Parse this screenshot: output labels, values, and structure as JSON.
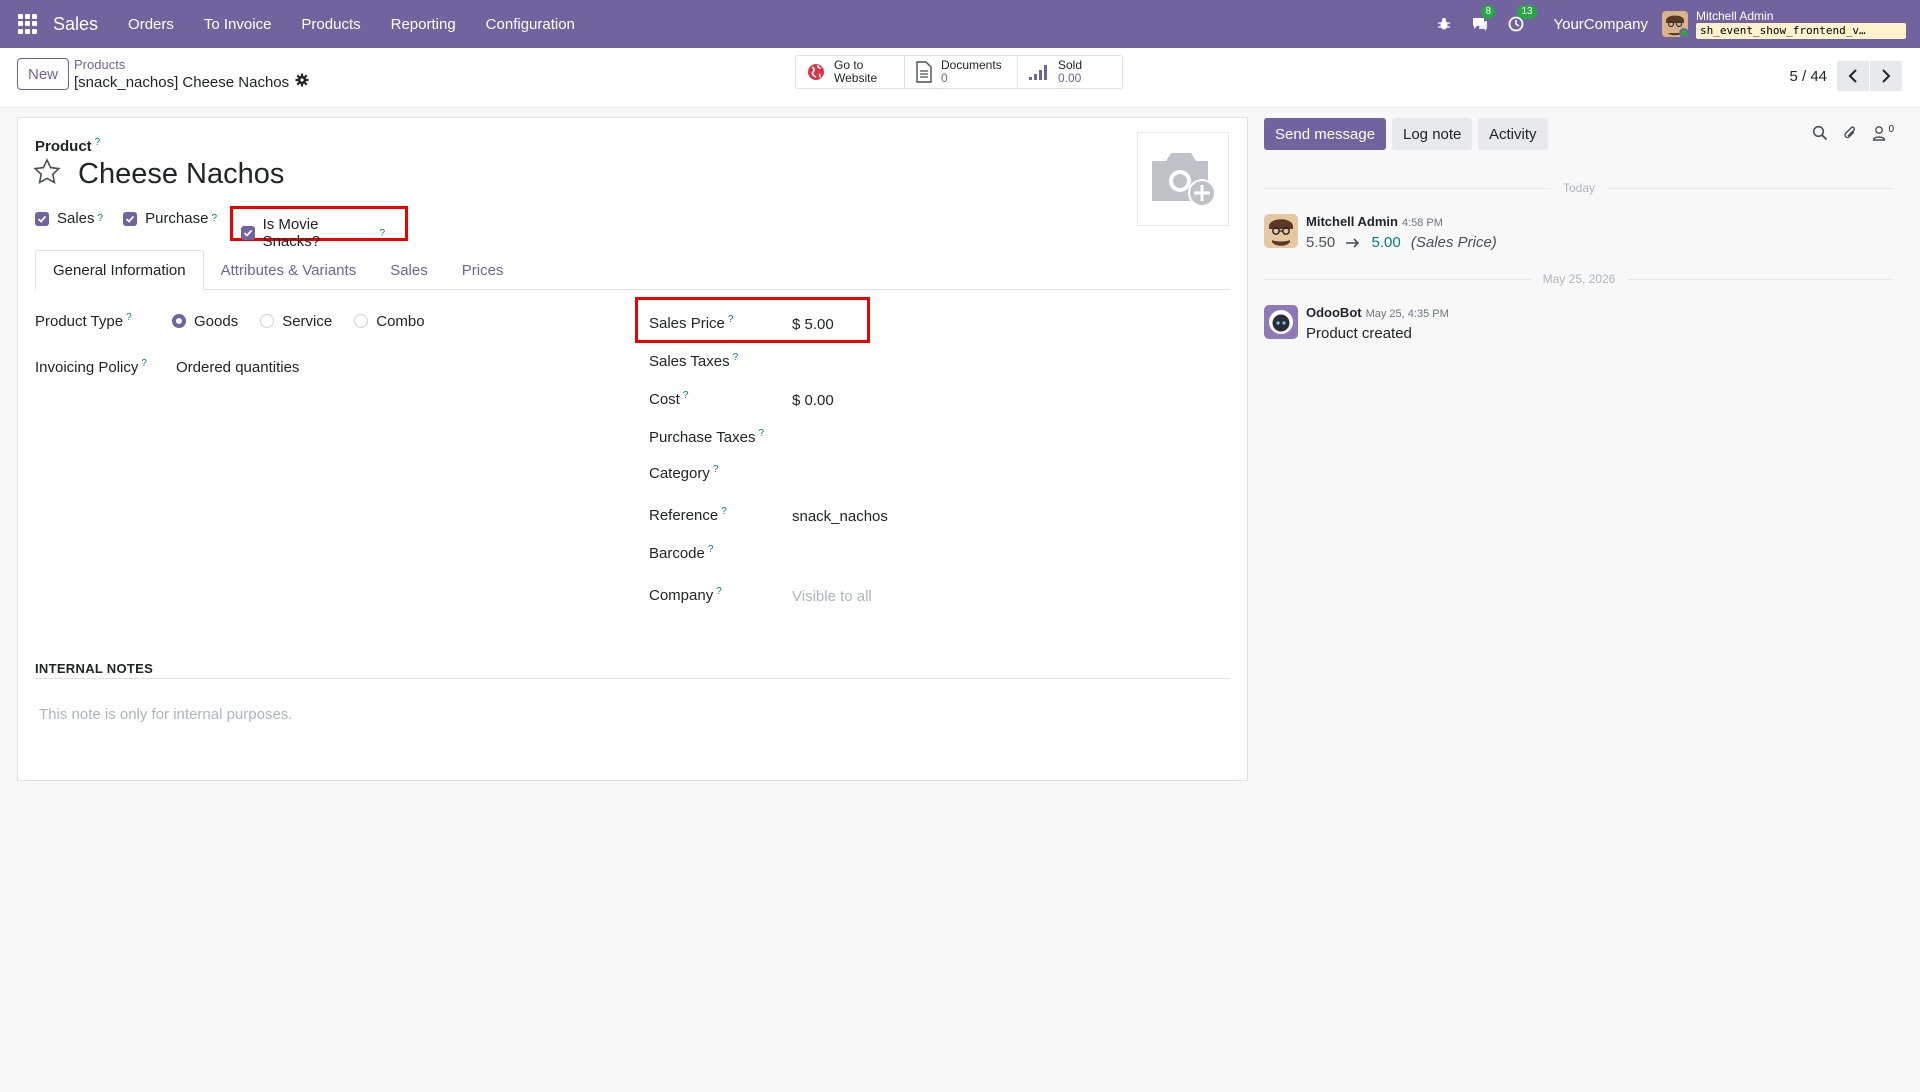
{
  "navbar": {
    "app_name": "Sales",
    "menu": [
      "Orders",
      "To Invoice",
      "Products",
      "Reporting",
      "Configuration"
    ],
    "messages_badge": "8",
    "activities_badge": "13",
    "company": "YourCompany",
    "user_name": "Mitchell Admin",
    "db_name": "sh_event_show_frontend_v…"
  },
  "control": {
    "new_label": "New",
    "breadcrumb_parent": "Products",
    "breadcrumb_current": "[snack_nachos] Cheese Nachos",
    "smart_buttons": {
      "website_line1": "Go to",
      "website_line2": "Website",
      "documents_label": "Documents",
      "documents_value": "0",
      "sold_label": "Sold",
      "sold_value": "0.00"
    },
    "pager": "5 / 44"
  },
  "form": {
    "product_label": "Product",
    "help_mark": "?",
    "title": "Cheese Nachos",
    "checkboxes": {
      "sales": "Sales",
      "purchase": "Purchase",
      "movie_snacks": "Is Movie Snacks?"
    },
    "tabs": [
      "General Information",
      "Attributes & Variants",
      "Sales",
      "Prices"
    ],
    "left": {
      "product_type_label": "Product Type",
      "product_type_options": [
        "Goods",
        "Service",
        "Combo"
      ],
      "product_type_selected": "Goods",
      "invoicing_policy_label": "Invoicing Policy",
      "invoicing_policy_value": "Ordered quantities"
    },
    "right": {
      "sales_price_label": "Sales Price",
      "sales_price_value": "$ 5.00",
      "sales_taxes_label": "Sales Taxes",
      "cost_label": "Cost",
      "cost_value": "$ 0.00",
      "purchase_taxes_label": "Purchase Taxes",
      "category_label": "Category",
      "reference_label": "Reference",
      "reference_value": "snack_nachos",
      "barcode_label": "Barcode",
      "company_label": "Company",
      "company_placeholder": "Visible to all"
    },
    "notes_title": "INTERNAL NOTES",
    "notes_placeholder": "This note is only for internal purposes."
  },
  "chatter": {
    "send_message": "Send message",
    "log_note": "Log note",
    "activity": "Activity",
    "followers_count": "0",
    "separators": [
      "Today",
      "May 25, 2026"
    ],
    "messages": [
      {
        "author": "Mitchell Admin",
        "time": "4:58 PM",
        "old_value": "5.50",
        "new_value": "5.00",
        "field": "(Sales Price)"
      },
      {
        "author": "OdooBot",
        "time": "May 25, 4:35 PM",
        "body": "Product created"
      }
    ]
  },
  "colors": {
    "brand": "#71639e",
    "highlight": "#ee0000",
    "help": "#017e84"
  }
}
